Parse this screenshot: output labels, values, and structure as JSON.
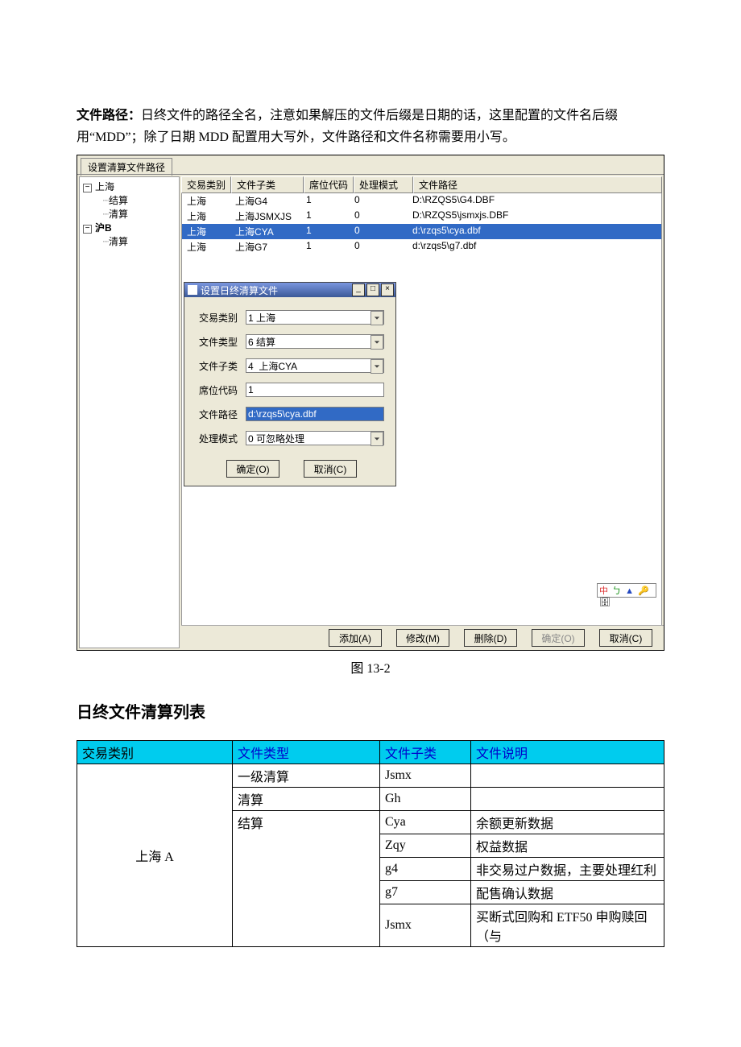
{
  "document": {
    "para_label": "文件路径：",
    "para_text": "日终文件的路径全名，注意如果解压的文件后缀是日期的话，这里配置的文件名后缀用“MDD”；除了日期 MDD 配置用大写外，文件路径和文件名称需要用小写。",
    "fig_caption": "图 13-2",
    "section_heading": "日终文件清算列表"
  },
  "screenshot": {
    "tab_label": "设置清算文件路径",
    "tree": {
      "n0": "上海",
      "n0a": "结算",
      "n0b": "清算",
      "n1": "沪B",
      "n1a": "清算"
    },
    "list": {
      "headers": [
        "交易类别",
        "文件子类",
        "席位代码",
        "处理模式",
        "文件路径"
      ],
      "rows": [
        {
          "c0": "上海",
          "c1": "上海G4",
          "c2": "1",
          "c3": "0",
          "c4": "D:\\RZQS5\\G4.DBF"
        },
        {
          "c0": "上海",
          "c1": "上海JSMXJS",
          "c2": "1",
          "c3": "0",
          "c4": "D:\\RZQS5\\jsmxjs.DBF"
        },
        {
          "c0": "上海",
          "c1": "上海CYA",
          "c2": "1",
          "c3": "0",
          "c4": "d:\\rzqs5\\cya.dbf"
        },
        {
          "c0": "上海",
          "c1": "上海G7",
          "c2": "1",
          "c3": "0",
          "c4": "d:\\rzqs5\\g7.dbf"
        }
      ]
    },
    "dialog": {
      "title": "设置日终清算文件",
      "fields": {
        "f1_label": "交易类别",
        "f1_value": "1 上海",
        "f2_label": "文件类型",
        "f2_value": "6 结算",
        "f3_label": "文件子类",
        "f3_value": "4  上海CYA",
        "f4_label": "席位代码",
        "f4_value": "1",
        "f5_label": "文件路径",
        "f5_value": "d:\\rzqs5\\cya.dbf",
        "f6_label": "处理模式",
        "f6_value": "0 可忽略处理"
      },
      "ok": "确定(O)",
      "cancel": "取消(C)"
    },
    "footer": {
      "add": "添加(A)",
      "mod": "修改(M)",
      "del": "删除(D)",
      "ok": "确定(O)",
      "cancel": "取消(C)"
    }
  },
  "table": {
    "headers": [
      "交易类别",
      "文件类型",
      "文件子类",
      "文件说明"
    ],
    "cat": "上海 A",
    "rows": [
      {
        "t": "一级清算",
        "s": "Jsmx",
        "d": ""
      },
      {
        "t": "清算",
        "s": "Gh",
        "d": ""
      },
      {
        "t": "结算",
        "s": "Cya",
        "d": "余额更新数据"
      },
      {
        "t": "",
        "s": "Zqy",
        "d": "权益数据"
      },
      {
        "t": "",
        "s": "g4",
        "d": "非交易过户数据，主要处理红利"
      },
      {
        "t": "",
        "s": "g7",
        "d": "配售确认数据"
      },
      {
        "t": "",
        "s": "Jsmx",
        "d": "买断式回购和 ETF50 申购赎回（与"
      }
    ]
  }
}
